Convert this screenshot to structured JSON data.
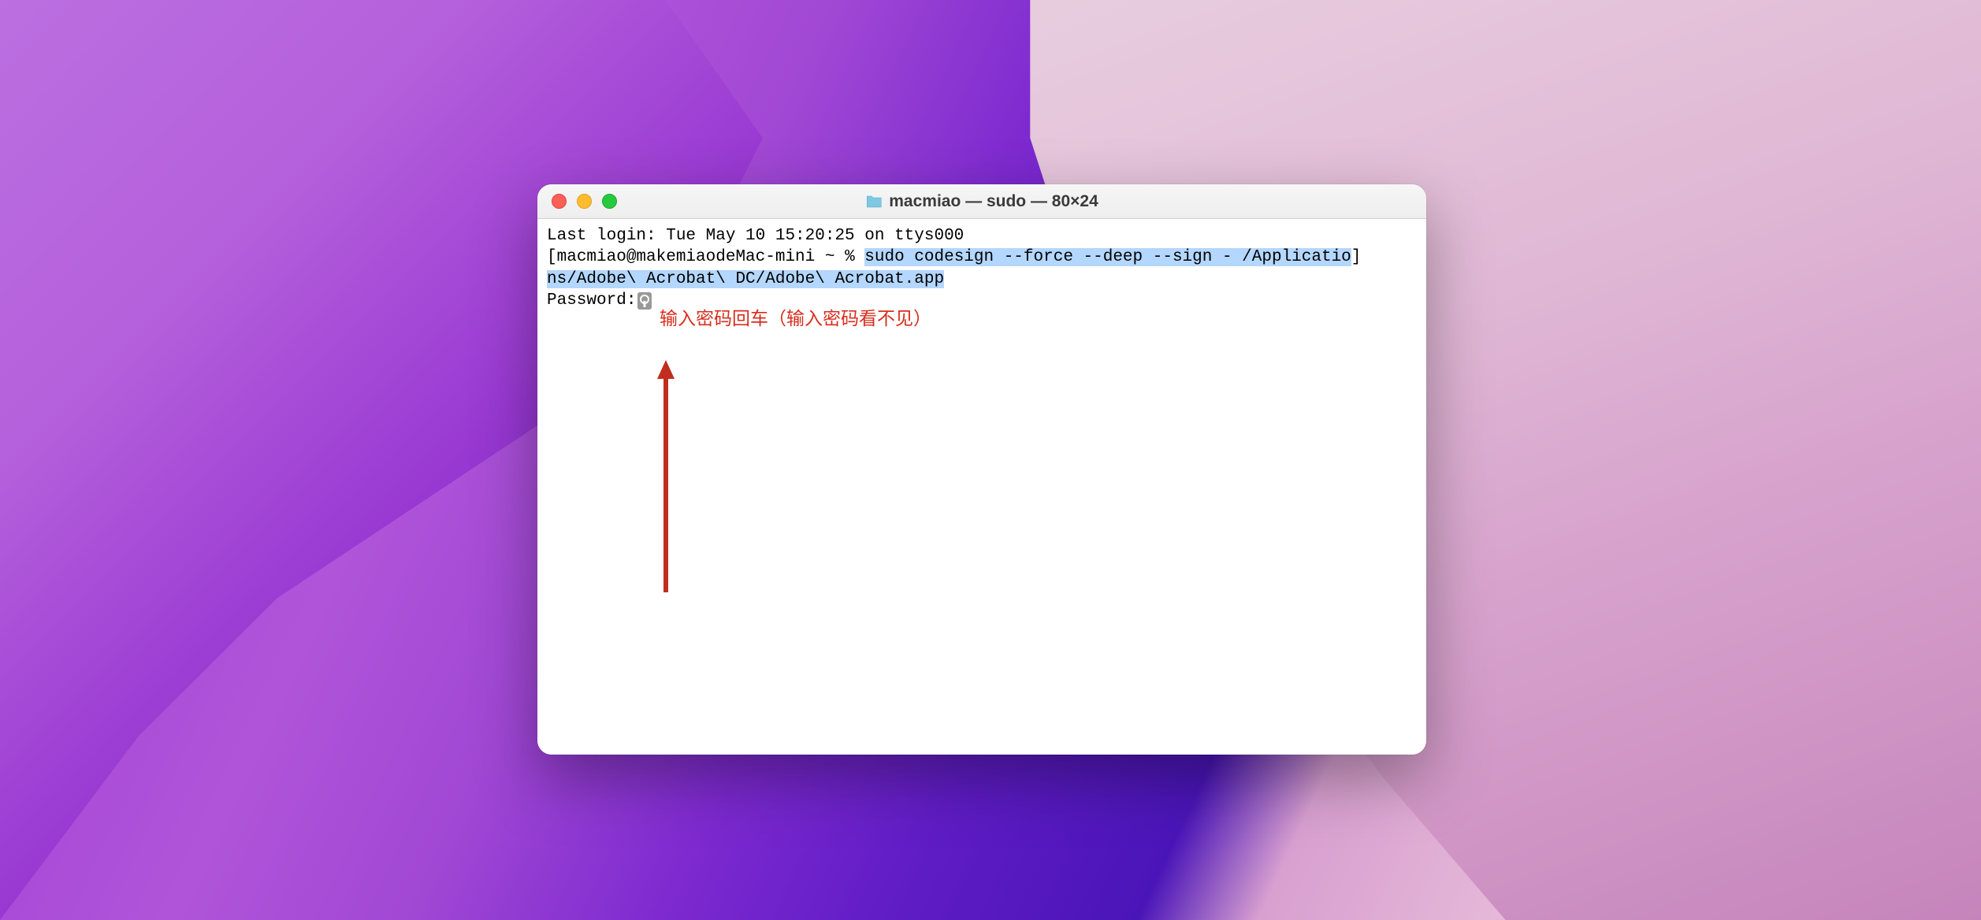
{
  "window": {
    "title": "macmiao — sudo — 80×24",
    "folder_icon": "folder-icon"
  },
  "traffic_lights": {
    "close": "close",
    "minimize": "minimize",
    "maximize": "maximize"
  },
  "terminal": {
    "last_login": "Last login: Tue May 10 15:20:25 on ttys000",
    "prompt_bracket_open": "[",
    "prompt_user_host": "macmiao@makemiaodeMac-mini ~ % ",
    "command_part1": "sudo codesign --force --deep --sign - /Applicatio",
    "prompt_bracket_close": "]",
    "command_part2": "ns/Adobe\\ Acrobat\\ DC/Adobe\\ Acrobat.app",
    "password_prompt": "Password:"
  },
  "annotation": {
    "text": "输入密码回车（输入密码看不见）",
    "arrow_color": "#c12e1e"
  }
}
